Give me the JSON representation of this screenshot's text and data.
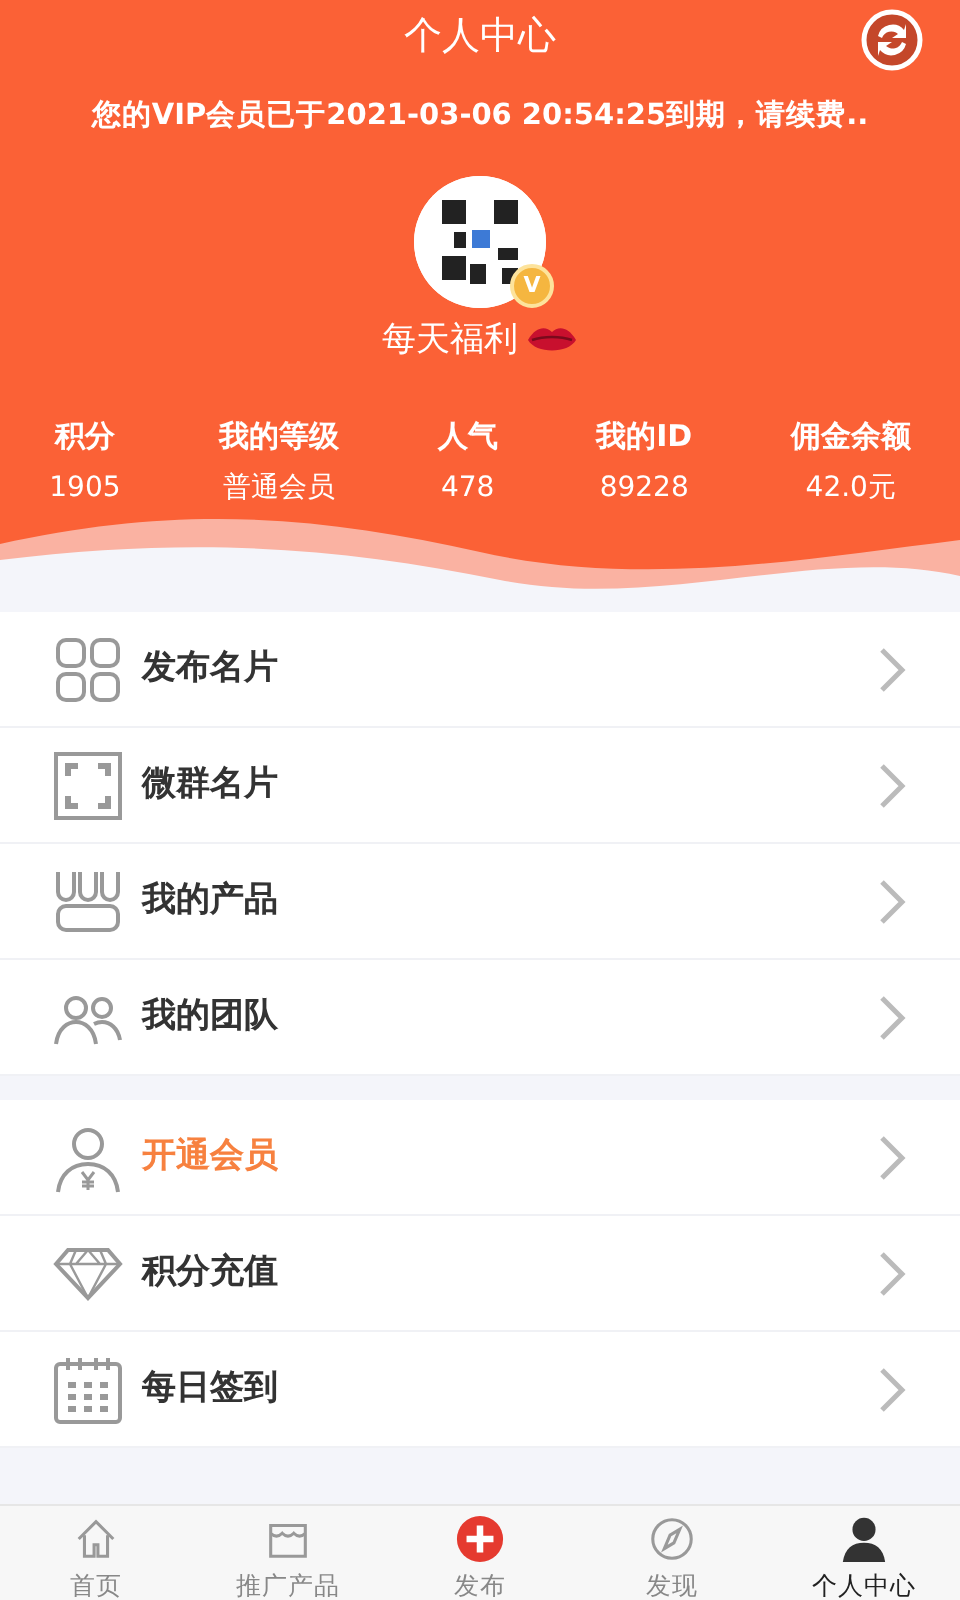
{
  "header": {
    "title": "个人中心",
    "notice": "您的VIP会员已于2021-03-06 20:54:25到期，请续费..",
    "avatar": {
      "badge": "V"
    },
    "nickname": "每天福利"
  },
  "stats": [
    {
      "label": "积分",
      "value": "1905"
    },
    {
      "label": "我的等级",
      "value": "普通会员"
    },
    {
      "label": "人气",
      "value": "478"
    },
    {
      "label": "我的ID",
      "value": "89228"
    },
    {
      "label": "佣金余额",
      "value": "42.0元"
    }
  ],
  "menu_groups": [
    [
      {
        "label": "发布名片",
        "highlighted": false
      },
      {
        "label": "微群名片",
        "highlighted": false
      },
      {
        "label": "我的产品",
        "highlighted": false
      },
      {
        "label": "我的团队",
        "highlighted": false
      }
    ],
    [
      {
        "label": "开通会员",
        "highlighted": true
      },
      {
        "label": "积分充值",
        "highlighted": false
      },
      {
        "label": "每日签到",
        "highlighted": false
      }
    ]
  ],
  "tab_bar": [
    {
      "label": "首页",
      "selected": false
    },
    {
      "label": "推广产品",
      "selected": false
    },
    {
      "label": "发布",
      "selected": false
    },
    {
      "label": "发现",
      "selected": false
    },
    {
      "label": "个人中心",
      "selected": true
    }
  ]
}
